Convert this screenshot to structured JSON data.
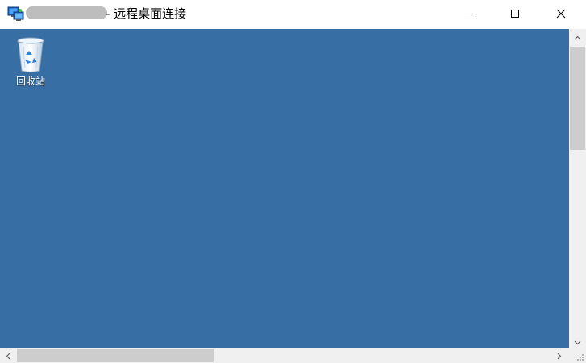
{
  "window": {
    "title_suffix": "- 远程桌面连接",
    "app_icon": "remote-desktop-icon",
    "controls": {
      "minimize_icon": "minimize-icon",
      "maximize_icon": "maximize-icon",
      "close_icon": "close-icon"
    }
  },
  "desktop": {
    "background_color": "#376ea3",
    "icons": [
      {
        "label": "回收站",
        "icon": "recycle-bin-icon"
      }
    ]
  },
  "scrollbars": {
    "vertical": {
      "up_icon": "chevron-up-icon",
      "down_icon": "chevron-down-icon"
    },
    "horizontal": {
      "left_icon": "chevron-left-icon",
      "right_icon": "chevron-right-icon"
    }
  }
}
